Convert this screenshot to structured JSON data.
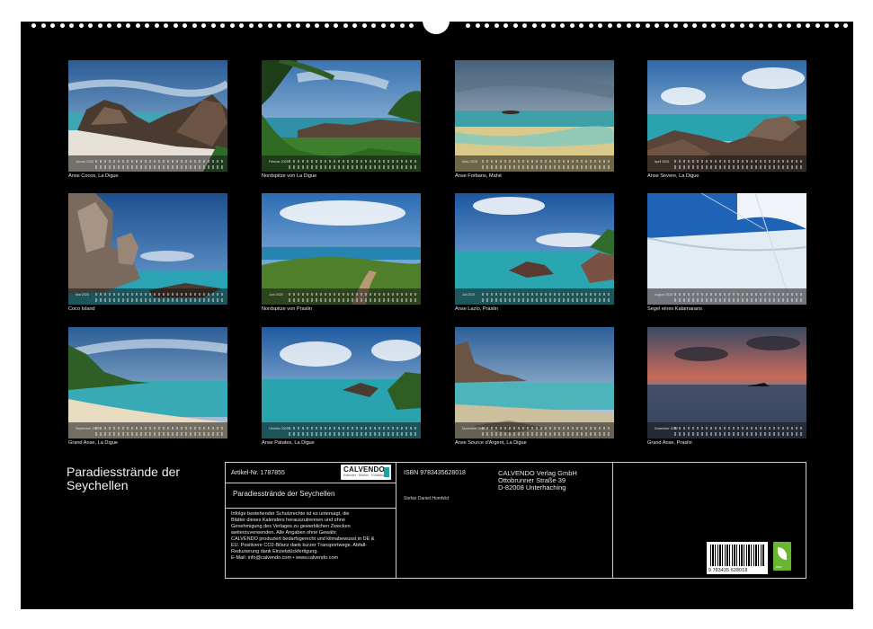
{
  "calendar": {
    "title": "Paradiesstrände der Seychellen"
  },
  "months": [
    {
      "month": "Januar 2025",
      "caption": "Anse Cocos, La Digue"
    },
    {
      "month": "Februar 2025",
      "caption": "Nordspitze von La Digue"
    },
    {
      "month": "März 2025",
      "caption": "Anse Forbans, Mahé"
    },
    {
      "month": "April 2025",
      "caption": "Anse Severe, La Digue"
    },
    {
      "month": "Mai 2025",
      "caption": "Coco Island"
    },
    {
      "month": "Juni 2025",
      "caption": "Nordspitze von Praslin"
    },
    {
      "month": "Juli 2025",
      "caption": "Anse Lazio, Praslin"
    },
    {
      "month": "August 2025",
      "caption": "Segel eines Katamarans"
    },
    {
      "month": "September 2025",
      "caption": "Grand Anse, La Digue"
    },
    {
      "month": "Oktober 2025",
      "caption": "Anse Patates, La Digue"
    },
    {
      "month": "November 2025",
      "caption": "Anse Source d'Argent, La Digue"
    },
    {
      "month": "Dezember 2025",
      "caption": "Grand Anse, Praslin"
    }
  ],
  "info_box": {
    "article_no": "Artikel-Nr. 1787855",
    "product_title": "Paradiesstrände der Seychellen",
    "isbn": "ISBN 9783435628018",
    "author": "Stefan Daniel Homfeld",
    "publisher_lines": [
      "CALVENDO Verlag GmbH",
      "Ottobrunner Straße 39",
      "D-82008 Unterhaching"
    ],
    "legal_text": [
      "Infolge bestehender Schutzrechte ist es untersagt, die",
      "Blätter dieses Kalenders herauszutrennen und ohne",
      "Genehmigung des Verlages zu gewerblichen Zwecken",
      "weiterzuverwenden. Alle Angaben ohne Gewähr.",
      "CALVENDO produziert bedarfsgerecht und klimabewusst in DE &",
      "EU. Positivere CO2-Bilanz dank kurzer Transportwege. Abfall-",
      "Reduzierung dank Einzelstückfertigung.",
      "E-Mail: info@calvendo.com • www.calvendo.com"
    ],
    "logo_name": "CALVENDO",
    "logo_sub": "Kalender · Bücher · Kunstdrucke",
    "barcode_number": "9 783435 628018",
    "eco_label": "eco"
  },
  "colors": {
    "background": "#000000",
    "text": "#e8e8e8",
    "border": "#cfcfcf",
    "logo_accent": "#1aa3a3",
    "eco_green": "#6bb62f"
  }
}
